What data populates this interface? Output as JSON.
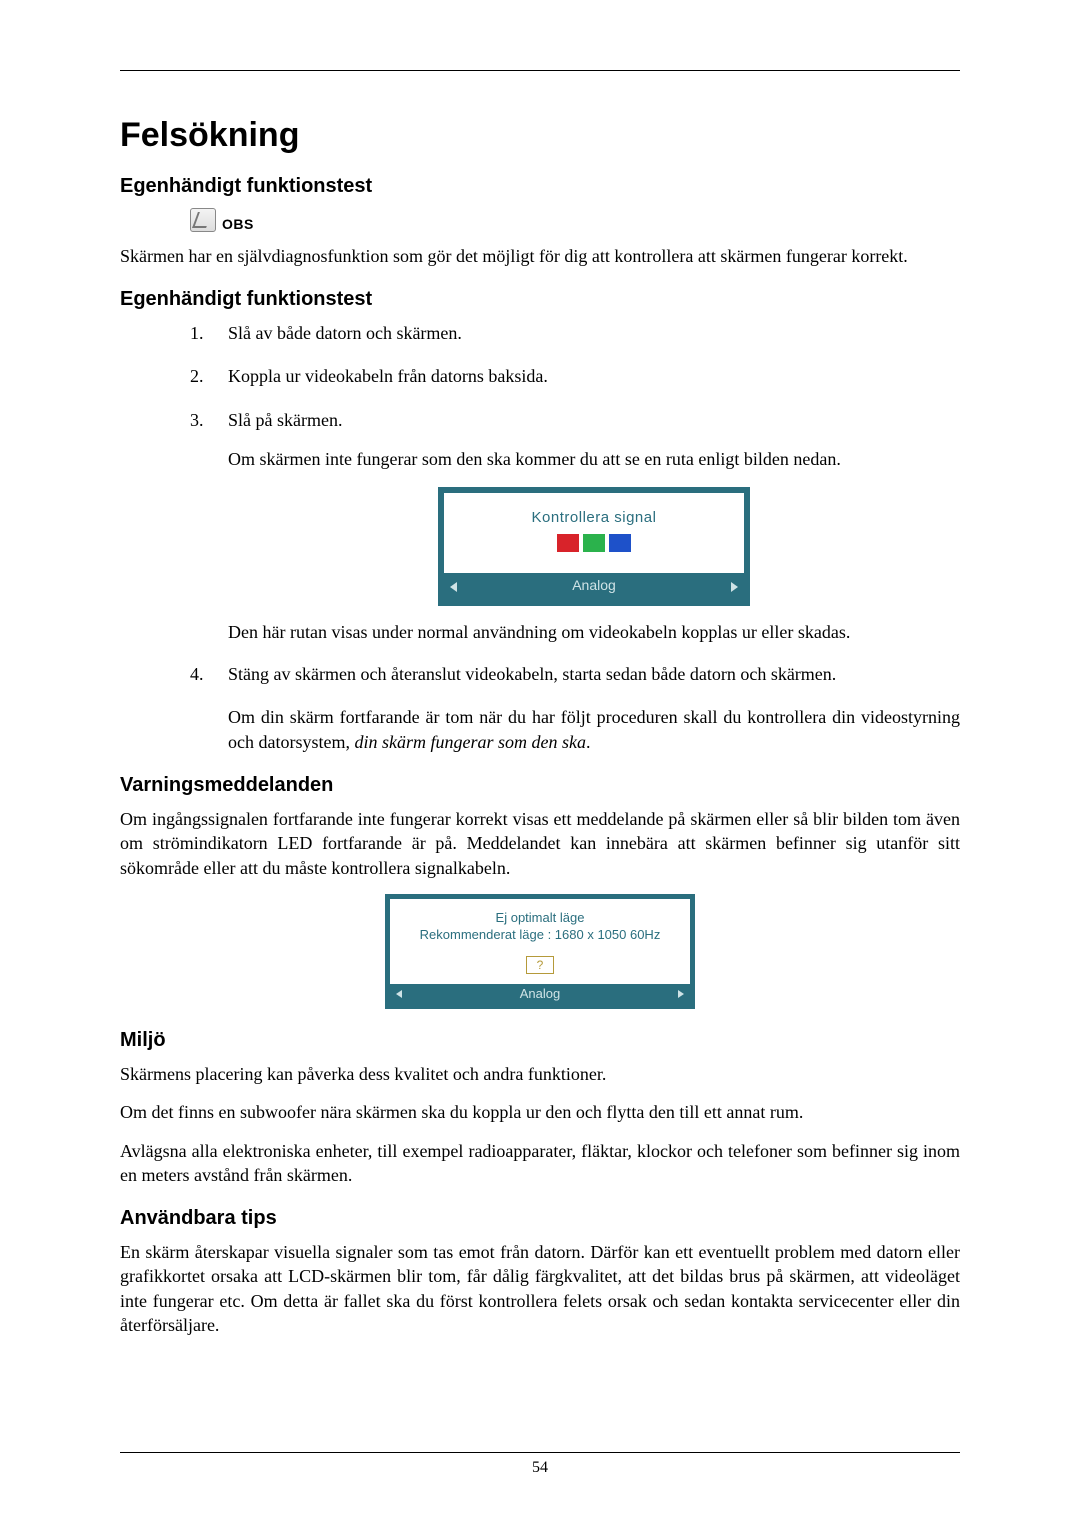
{
  "page_number": "54",
  "title": "Felsökning",
  "sec1": {
    "heading": "Egenhändigt funktionstest",
    "note_label": "OBS",
    "para": "Skärmen har en självdiagnosfunktion som gör det möjligt för dig att kontrollera att skärmen fungerar korrekt."
  },
  "sec2": {
    "heading": "Egenhändigt funktionstest",
    "steps": [
      "Slå av både datorn och skärmen.",
      "Koppla ur videokabeln från datorns baksida.",
      "Slå på skärmen."
    ],
    "step3_follow": "Om skärmen inte fungerar som den ska kommer du att se en ruta enligt bilden nedan.",
    "signal_box": {
      "top": "Kontrollera signal",
      "foot": "Analog"
    },
    "step3_after": "Den här rutan visas under normal användning om videokabeln kopplas ur eller skadas.",
    "step4": "Stäng av skärmen och återanslut videokabeln, starta sedan både datorn och skärmen.",
    "after_para": "Om din skärm fortfarande är tom när du har följt proceduren skall du kontrollera din videostyrning och datorsystem, ",
    "after_para_italic": "din skärm fungerar som den ska",
    "after_para_tail": "."
  },
  "sec3": {
    "heading": "Varningsmeddelanden",
    "para": "Om ingångssignalen fortfarande inte fungerar korrekt visas ett meddelande på skärmen eller så blir bilden tom även om strömindikatorn LED fortfarande är på. Meddelandet kan innebära att skärmen befinner sig utanför sitt sökområde eller att du måste kontrollera signalkabeln.",
    "warn_box": {
      "line1": "Ej optimalt läge",
      "line2": "Rekommenderat läge : 1680 x 1050  60Hz",
      "btn": "?",
      "foot": "Analog"
    }
  },
  "sec4": {
    "heading": "Miljö",
    "p1": "Skärmens placering kan påverka dess kvalitet och andra funktioner.",
    "p2": "Om det finns en subwoofer nära skärmen ska du koppla ur den och flytta den till ett annat rum.",
    "p3": "Avlägsna alla elektroniska enheter, till exempel radioapparater, fläktar, klockor och telefoner som befinner sig inom en meters avstånd från skärmen."
  },
  "sec5": {
    "heading": "Användbara tips",
    "p1": "En skärm återskapar visuella signaler som tas emot från datorn. Därför kan ett eventuellt problem med datorn eller grafikkortet orsaka att LCD-skärmen blir tom, får dålig färgkvalitet, att det bildas brus på skärmen, att videoläget inte fungerar etc. Om detta är fallet ska du först kontrollera felets orsak och sedan kontakta servicecenter eller din återförsäljare."
  }
}
